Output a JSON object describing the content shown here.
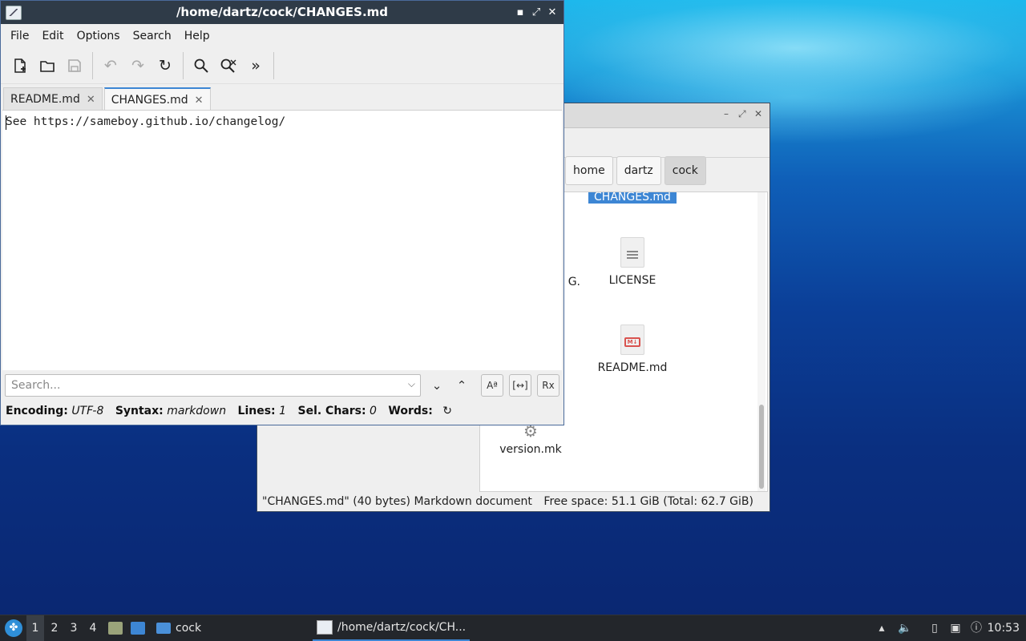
{
  "file_manager": {
    "breadcrumbs": [
      "home",
      "dartz",
      "cock"
    ],
    "items": [
      {
        "name": "CHANGES.md",
        "selected": true
      },
      {
        "name": "LICENSE",
        "icon": "text-file-icon"
      },
      {
        "name": "README.md",
        "icon": "markdown-file-icon"
      },
      {
        "name": "version.mk",
        "icon": "gear-file-icon"
      },
      {
        "name": "G.",
        "partial": true
      }
    ],
    "status_left": "\"CHANGES.md\" (40 bytes) Markdown document",
    "status_right": "Free space: 51.1 GiB (Total: 62.7 GiB)"
  },
  "editor": {
    "title": "/home/dartz/cock/CHANGES.md",
    "menu": [
      "File",
      "Edit",
      "Options",
      "Search",
      "Help"
    ],
    "toolbar": [
      "new-file-icon",
      "open-file-icon",
      "save-icon",
      "undo-icon",
      "redo-icon",
      "reload-icon",
      "find-icon",
      "replace-icon",
      "more-icon"
    ],
    "tabs": [
      {
        "label": "README.md",
        "active": false
      },
      {
        "label": "CHANGES.md",
        "active": true
      }
    ],
    "content": "See https://sameboy.github.io/changelog/",
    "search_placeholder": "Search...",
    "status": {
      "encoding_label": "Encoding:",
      "encoding": "UTF-8",
      "syntax_label": "Syntax:",
      "syntax": "markdown",
      "lines_label": "Lines:",
      "lines": "1",
      "selchars_label": "Sel. Chars:",
      "selchars": "0",
      "words_label": "Words:"
    }
  },
  "taskbar": {
    "workspaces": [
      "1",
      "2",
      "3",
      "4"
    ],
    "tasks": [
      {
        "label": "cock",
        "icon": "folder-icon"
      },
      {
        "label": "/home/dartz/cock/CH...",
        "icon": "editor-icon",
        "active": true
      }
    ],
    "clock": "10:53"
  }
}
